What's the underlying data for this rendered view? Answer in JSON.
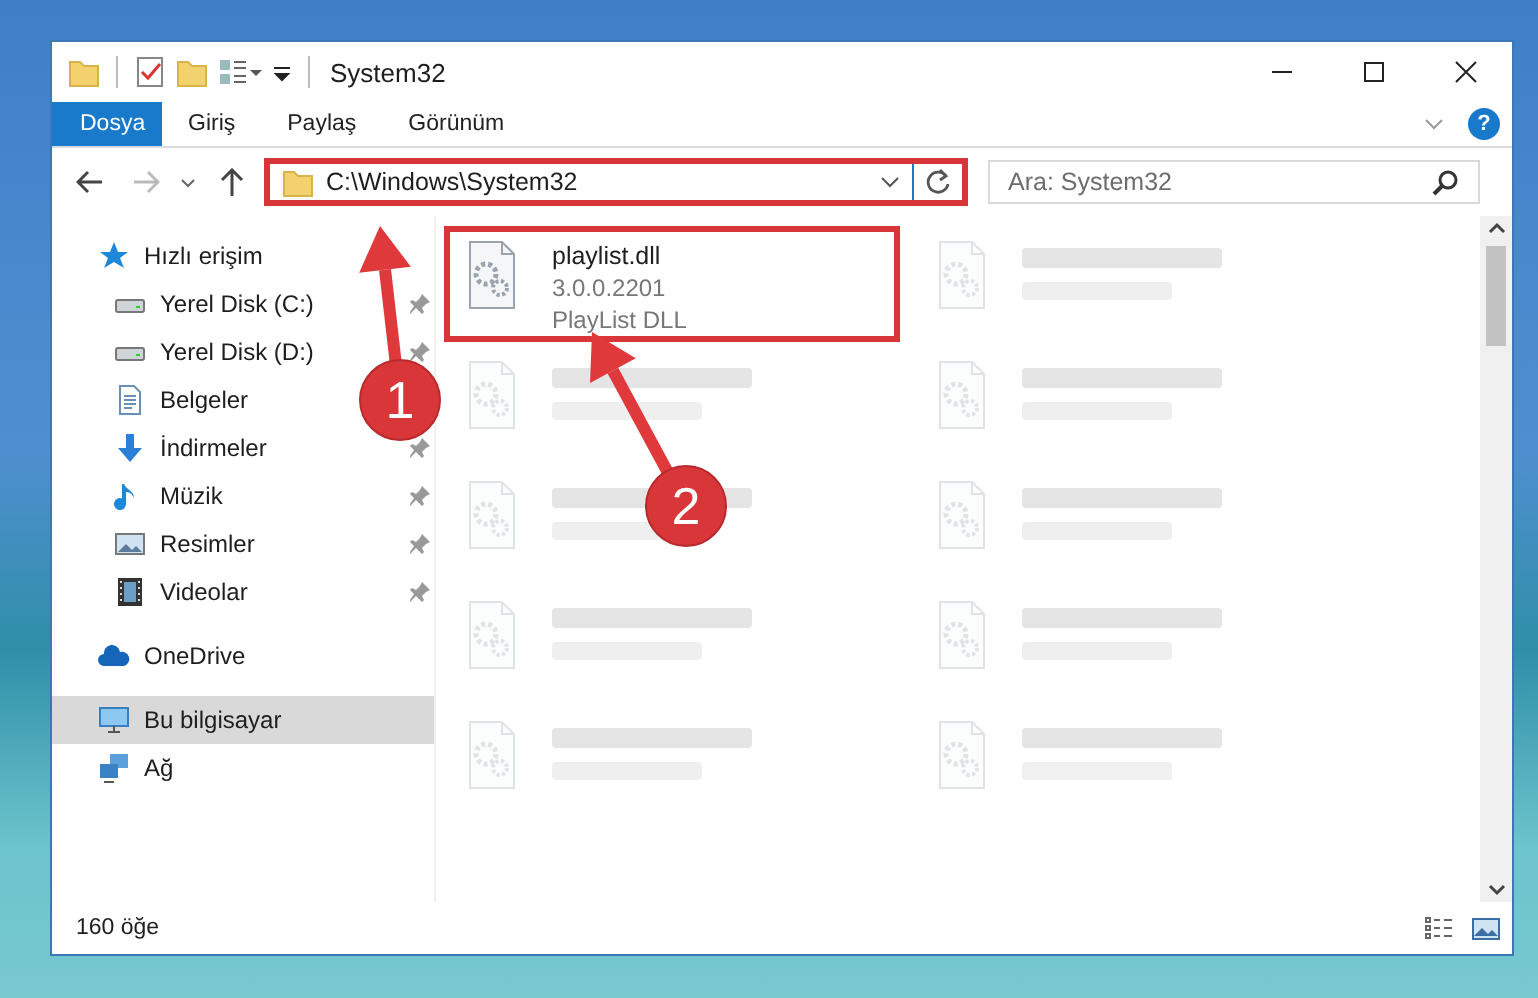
{
  "window": {
    "title": "System32"
  },
  "ribbon_tabs": [
    {
      "label": "Dosya",
      "selected": true
    },
    {
      "label": "Giriş",
      "selected": false
    },
    {
      "label": "Paylaş",
      "selected": false
    },
    {
      "label": "Görünüm",
      "selected": false
    }
  ],
  "address_bar": {
    "value": "C:\\Windows\\System32",
    "highlighted": true
  },
  "search": {
    "placeholder": "Ara: System32"
  },
  "sidebar": {
    "items": [
      {
        "label": "Hızlı erişim",
        "kind": "star",
        "selected": false,
        "children": [
          {
            "label": "Yerel Disk (C:)",
            "kind": "drive",
            "pinned": true,
            "selected": false
          },
          {
            "label": "Yerel Disk (D:)",
            "kind": "drive",
            "pinned": true,
            "selected": false
          },
          {
            "label": "Belgeler",
            "kind": "document",
            "selected": false
          },
          {
            "label": "İndirmeler",
            "kind": "download",
            "pinned": true,
            "selected": false
          },
          {
            "label": "Müzik",
            "kind": "music",
            "pinned": true,
            "selected": false
          },
          {
            "label": "Resimler",
            "kind": "picture",
            "pinned": true,
            "selected": false
          },
          {
            "label": "Videolar",
            "kind": "video",
            "pinned": true,
            "selected": false
          }
        ]
      },
      {
        "label": "OneDrive",
        "kind": "cloud",
        "selected": false
      },
      {
        "label": "Bu bilgisayar",
        "kind": "computer",
        "selected": true
      },
      {
        "label": "Ağ",
        "kind": "network",
        "selected": false
      }
    ]
  },
  "files": [
    {
      "kind": "file",
      "name": "playlist.dll",
      "version": "3.0.0.2201",
      "description": "PlayList DLL",
      "highlighted": true
    },
    {
      "kind": "blurred",
      "highlighted": false
    },
    {
      "kind": "blurred",
      "highlighted": false
    },
    {
      "kind": "blurred",
      "highlighted": false
    },
    {
      "kind": "blurred",
      "highlighted": false
    },
    {
      "kind": "blurred",
      "highlighted": false
    },
    {
      "kind": "blurred",
      "highlighted": false
    },
    {
      "kind": "blurred",
      "highlighted": false
    },
    {
      "kind": "blurred",
      "highlighted": false
    },
    {
      "kind": "blurred",
      "highlighted": false
    }
  ],
  "status_bar": {
    "item_count": "160 öğe"
  },
  "help_button": {
    "label": "?"
  },
  "annotations": [
    {
      "label": "1"
    },
    {
      "label": "2"
    }
  ]
}
